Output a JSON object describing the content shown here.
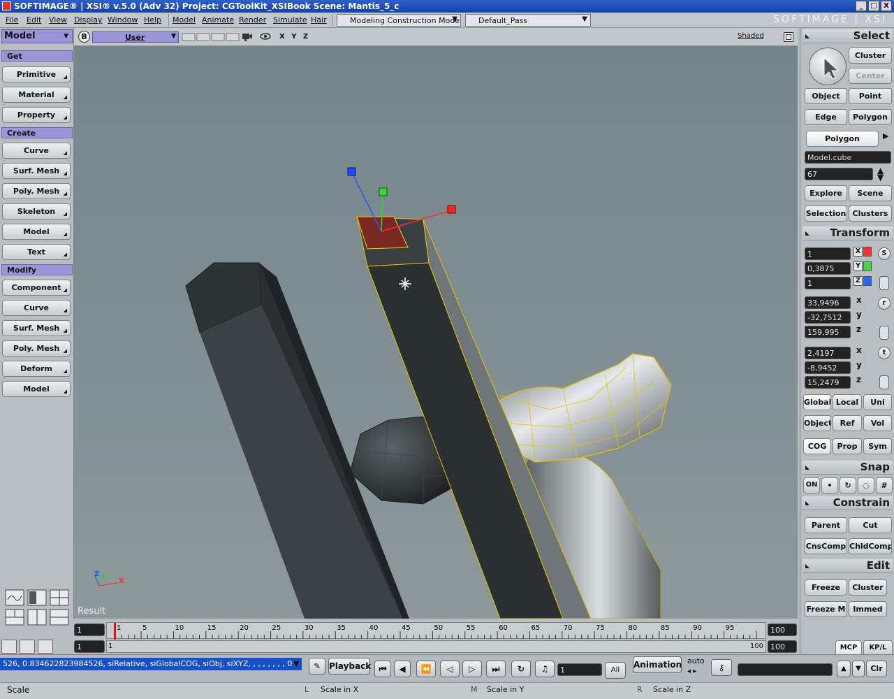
{
  "title": {
    "text": "SOFTIMAGE® | XSI® v.5.0 (Adv 32) Project: CGToolKit_XSIBook     Scene: Mantis_5_c"
  },
  "window_buttons": [
    "_",
    "□",
    "X"
  ],
  "menu": [
    "File",
    "Edit",
    "View",
    "Display",
    "Window",
    "Help",
    "Model",
    "Animate",
    "Render",
    "Simulate",
    "Hair"
  ],
  "mode_dropdown": "Modeling Construction Mode",
  "pass_dropdown": "Default_Pass",
  "brand": "SOFTIMAGE | XSI",
  "left": {
    "module": "Model",
    "get_header": "Get",
    "get_items": [
      "Primitive",
      "Material",
      "Property"
    ],
    "create_header": "Create",
    "create_items": [
      "Curve",
      "Surf. Mesh",
      "Poly. Mesh",
      "Skeleton",
      "Model",
      "Text"
    ],
    "modify_header": "Modify",
    "modify_items": [
      "Component",
      "Curve",
      "Surf. Mesh",
      "Poly. Mesh",
      "Deform",
      "Model"
    ]
  },
  "viewport": {
    "label": "B",
    "camera": "User",
    "axes": "X Y Z",
    "shading": "Shaded",
    "result_label": "Result",
    "gizmo_x": "X",
    "gizmo_y": "Y",
    "gizmo_z": "Z"
  },
  "right": {
    "select_header": "Select",
    "select_buttons": [
      "Cluster",
      "Center",
      "Object",
      "Point",
      "Edge",
      "Polygon"
    ],
    "filter": "Polygon",
    "object_name": "Model.cube",
    "count": "67",
    "explore_buttons": [
      "Explore",
      "Scene",
      "Selection",
      "Clusters"
    ],
    "transform_header": "Transform",
    "scale": [
      "1",
      "0,3875",
      "1"
    ],
    "rotate": [
      "33,9496",
      "-32,7512",
      "159,995"
    ],
    "translate": [
      "2,4197",
      "-8,9452",
      "15,2479"
    ],
    "axis_letters": [
      "x",
      "y",
      "z"
    ],
    "side_letters": [
      "S",
      "r",
      "t"
    ],
    "space_buttons": [
      "Global",
      "Local",
      "Uni",
      "Object",
      "Ref",
      "Vol",
      "COG",
      "Prop",
      "Sym"
    ],
    "snap_header": "Snap",
    "snap_on": "ON",
    "constrain_header": "Constrain",
    "constrain_buttons": [
      "Parent",
      "Cut",
      "CnsComp",
      "ChldComp"
    ],
    "edit_header": "Edit",
    "edit_buttons": [
      "Freeze",
      "Cluster",
      "Freeze M",
      "Immed"
    ],
    "mcp": "MCP",
    "kpl": "KP/L"
  },
  "timeline": {
    "start": "1",
    "start2": "1",
    "current_low": "1",
    "end": "100",
    "end2": "100",
    "end_small": "100",
    "ticks": [
      "1",
      "5",
      "10",
      "15",
      "20",
      "25",
      "30",
      "35",
      "40",
      "45",
      "50",
      "55",
      "60",
      "65",
      "70",
      "75",
      "80",
      "85",
      "90",
      "95"
    ]
  },
  "command_line": "526, 0.834622823984526, siRelative, siGlobalCOG, siObj, siXYZ, , , , , , , , 0",
  "playback": {
    "label": "Playback",
    "frame": "1",
    "all": "All",
    "animation": "Animation",
    "auto": "auto",
    "clr": "Clr"
  },
  "status": {
    "left": "Scale",
    "l_key": "L",
    "l_text": "Scale in X",
    "m_key": "M",
    "m_text": "Scale in Y",
    "r_key": "R",
    "r_text": "Scale in Z"
  }
}
